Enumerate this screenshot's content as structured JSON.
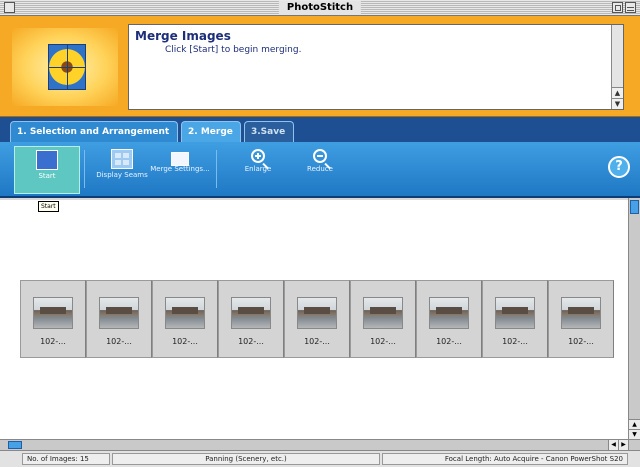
{
  "window": {
    "title": "PhotoStitch"
  },
  "header": {
    "title": "Merge Images",
    "instruction": "Click [Start] to begin merging."
  },
  "tabs": [
    {
      "label": "1. Selection and Arrangement",
      "active": false
    },
    {
      "label": "2. Merge",
      "active": true
    },
    {
      "label": "3.Save",
      "active": false
    }
  ],
  "toolbar": {
    "start": "Start",
    "display_seams": "Display Seams",
    "merge_settings": "Merge Settings...",
    "enlarge": "Enlarge",
    "reduce": "Reduce",
    "help": "?"
  },
  "tooltip": "Start",
  "thumbnails": [
    {
      "name": "102-..."
    },
    {
      "name": "102-..."
    },
    {
      "name": "102-..."
    },
    {
      "name": "102-..."
    },
    {
      "name": "102-..."
    },
    {
      "name": "102-..."
    },
    {
      "name": "102-..."
    },
    {
      "name": "102-..."
    },
    {
      "name": "102-..."
    }
  ],
  "status": {
    "images": "No. of Images: 15",
    "mode": "Panning (Scenery, etc.)",
    "focal": "Focal Length: Auto Acquire - Canon PowerShot S20"
  },
  "colors": {
    "header_bg": "#f6a924",
    "tabs_bg": "#1d4f92",
    "toolbar_bg": "#2f8ad2",
    "start_active": "#5fc7c2"
  }
}
